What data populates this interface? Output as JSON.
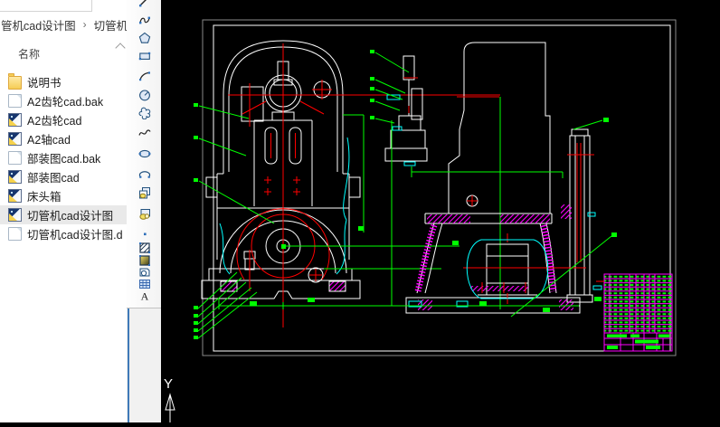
{
  "explorer": {
    "breadcrumb": {
      "folder": "管机cad设计图",
      "chevron": "›",
      "current": "切管机"
    },
    "column_header": "名称",
    "files": [
      {
        "name": "说明书",
        "icon": "folder",
        "selected": "false"
      },
      {
        "name": "A2齿轮cad.bak",
        "icon": "bak",
        "selected": "false"
      },
      {
        "name": "A2齿轮cad",
        "icon": "dwg",
        "selected": "false"
      },
      {
        "name": "A2轴cad",
        "icon": "dwg",
        "selected": "false"
      },
      {
        "name": "部装图cad.bak",
        "icon": "bak",
        "selected": "false"
      },
      {
        "name": "部装图cad",
        "icon": "dwg",
        "selected": "false"
      },
      {
        "name": "床头箱",
        "icon": "dwg",
        "selected": "false"
      },
      {
        "name": "切管机cad设计图",
        "icon": "dwg",
        "selected": "true"
      },
      {
        "name": "切管机cad设计图.d",
        "icon": "bak",
        "selected": "false"
      }
    ]
  },
  "toolbar": {
    "items": [
      "line",
      "polyline",
      "polygon",
      "rectangle",
      "arc",
      "circle",
      "revision-cloud",
      "spline",
      "ellipse",
      "ellipse-arc",
      "insert-block",
      "make-block",
      "point",
      "hatch",
      "gradient",
      "region",
      "table",
      "multiline-text"
    ]
  },
  "canvas": {
    "ucs_label": "Y",
    "colors": {
      "background": "#000000",
      "outline": "#ffffff",
      "centerline": "#ff0000",
      "dimension": "#00ff00",
      "auxiliary": "#00ffff",
      "hatch": "#ff00ff",
      "sheet_border": "#8a8a8a"
    }
  }
}
